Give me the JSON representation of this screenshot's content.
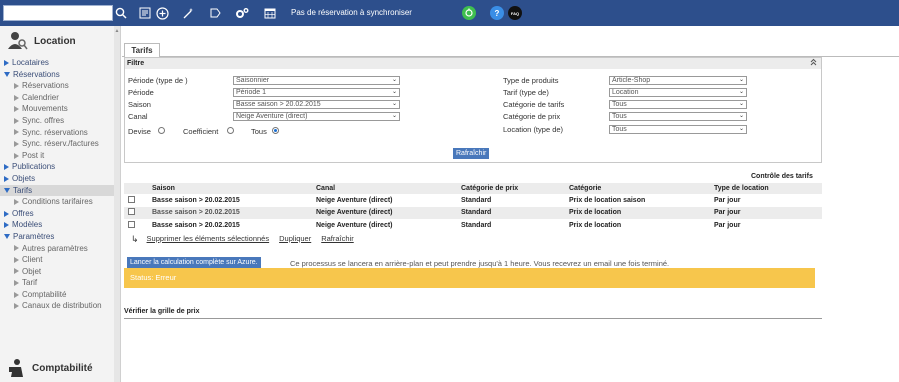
{
  "topbar": {
    "search_placeholder": "",
    "sync_text": "Pas de réservation à synchroniser",
    "help_label": "?",
    "faq_label": "FAQ",
    "icons": [
      "search-icon",
      "list-icon",
      "plus-circle-icon",
      "magic-wand-icon",
      "tag-icon",
      "gears-icon",
      "calendar-icon"
    ]
  },
  "sidebar": {
    "title": "Location",
    "footer_title": "Comptabilité",
    "items": [
      {
        "label": "Locataires",
        "type": "closed"
      },
      {
        "label": "Réservations",
        "type": "open"
      },
      {
        "label": "Réservations",
        "type": "sub"
      },
      {
        "label": "Calendrier",
        "type": "sub"
      },
      {
        "label": "Mouvements",
        "type": "sub"
      },
      {
        "label": "Sync. offres",
        "type": "sub"
      },
      {
        "label": "Sync. réservations",
        "type": "sub"
      },
      {
        "label": "Sync. réserv./factures",
        "type": "sub"
      },
      {
        "label": "Post it",
        "type": "sub"
      },
      {
        "label": "Publications",
        "type": "closed"
      },
      {
        "label": "Objets",
        "type": "closed"
      },
      {
        "label": "Tarifs",
        "type": "open-active"
      },
      {
        "label": "Conditions tarifaires",
        "type": "sub"
      },
      {
        "label": "Offres",
        "type": "closed"
      },
      {
        "label": "Modèles",
        "type": "closed"
      },
      {
        "label": "Paramètres",
        "type": "open"
      },
      {
        "label": "Autres paramètres",
        "type": "sub"
      },
      {
        "label": "Client",
        "type": "sub"
      },
      {
        "label": "Objet",
        "type": "sub"
      },
      {
        "label": "Tarif",
        "type": "sub"
      },
      {
        "label": "Comptabilité",
        "type": "sub"
      },
      {
        "label": "Canaux de distribution",
        "type": "sub"
      }
    ]
  },
  "tab": {
    "label": "Tarifs"
  },
  "filter": {
    "title": "Filtre",
    "periode_type_label": "Période (type de )",
    "periode_type_value": "Saisonnier",
    "periode_label": "Période",
    "periode_value": "Période 1",
    "saison_label": "Saison",
    "saison_value": "Basse saison > 20.02.2015",
    "canal_label": "Canal",
    "canal_value": "Neige Aventure (direct)",
    "type_produits_label": "Type de produits",
    "type_produits_value": "Article-Shop",
    "tarif_type_label": "Tarif (type de)",
    "tarif_type_value": "Location",
    "cat_tarifs_label": "Catégorie de tarifs",
    "cat_tarifs_value": "Tous",
    "cat_prix_label": "Catégorie de prix",
    "cat_prix_value": "Tous",
    "location_type_label": "Location (type de)",
    "location_type_value": "Tous",
    "radio_devise": "Devise",
    "radio_coefficient": "Coefficient",
    "radio_tous": "Tous",
    "refresh_button": "Rafraîchir"
  },
  "results": {
    "control_title": "Contrôle des tarifs",
    "columns": [
      "Saison",
      "Canal",
      "Catégorie de prix",
      "Catégorie",
      "Type de location"
    ],
    "rows": [
      [
        "Basse saison > 20.02.2015",
        "Neige Aventure (direct)",
        "Standard",
        "Prix de location saison",
        "Par jour"
      ],
      [
        "Basse saison > 20.02.2015",
        "Neige Aventure (direct)",
        "Standard",
        "Prix de location",
        "Par jour"
      ],
      [
        "Basse saison > 20.02.2015",
        "Neige Aventure (direct)",
        "Standard",
        "Prix de location",
        "Par jour"
      ]
    ]
  },
  "actions": {
    "delete": "Supprimer les éléments sélectionnés",
    "duplicate": "Dupliquer",
    "refresh": "Rafraîchir"
  },
  "azure": {
    "button": "Lancer la calculation complète sur Azure.",
    "info": "Ce processus se lancera en arrière-plan et peut prendre jusqu'à 1 heure. Vous recevrez un email une fois terminé.",
    "status": "Status: Erreur"
  },
  "verify": {
    "title": "Vérifier la grille de prix"
  },
  "colors": {
    "topbar": "#2d4f8c",
    "accent": "#4978bb",
    "status": "#f7c64c"
  }
}
